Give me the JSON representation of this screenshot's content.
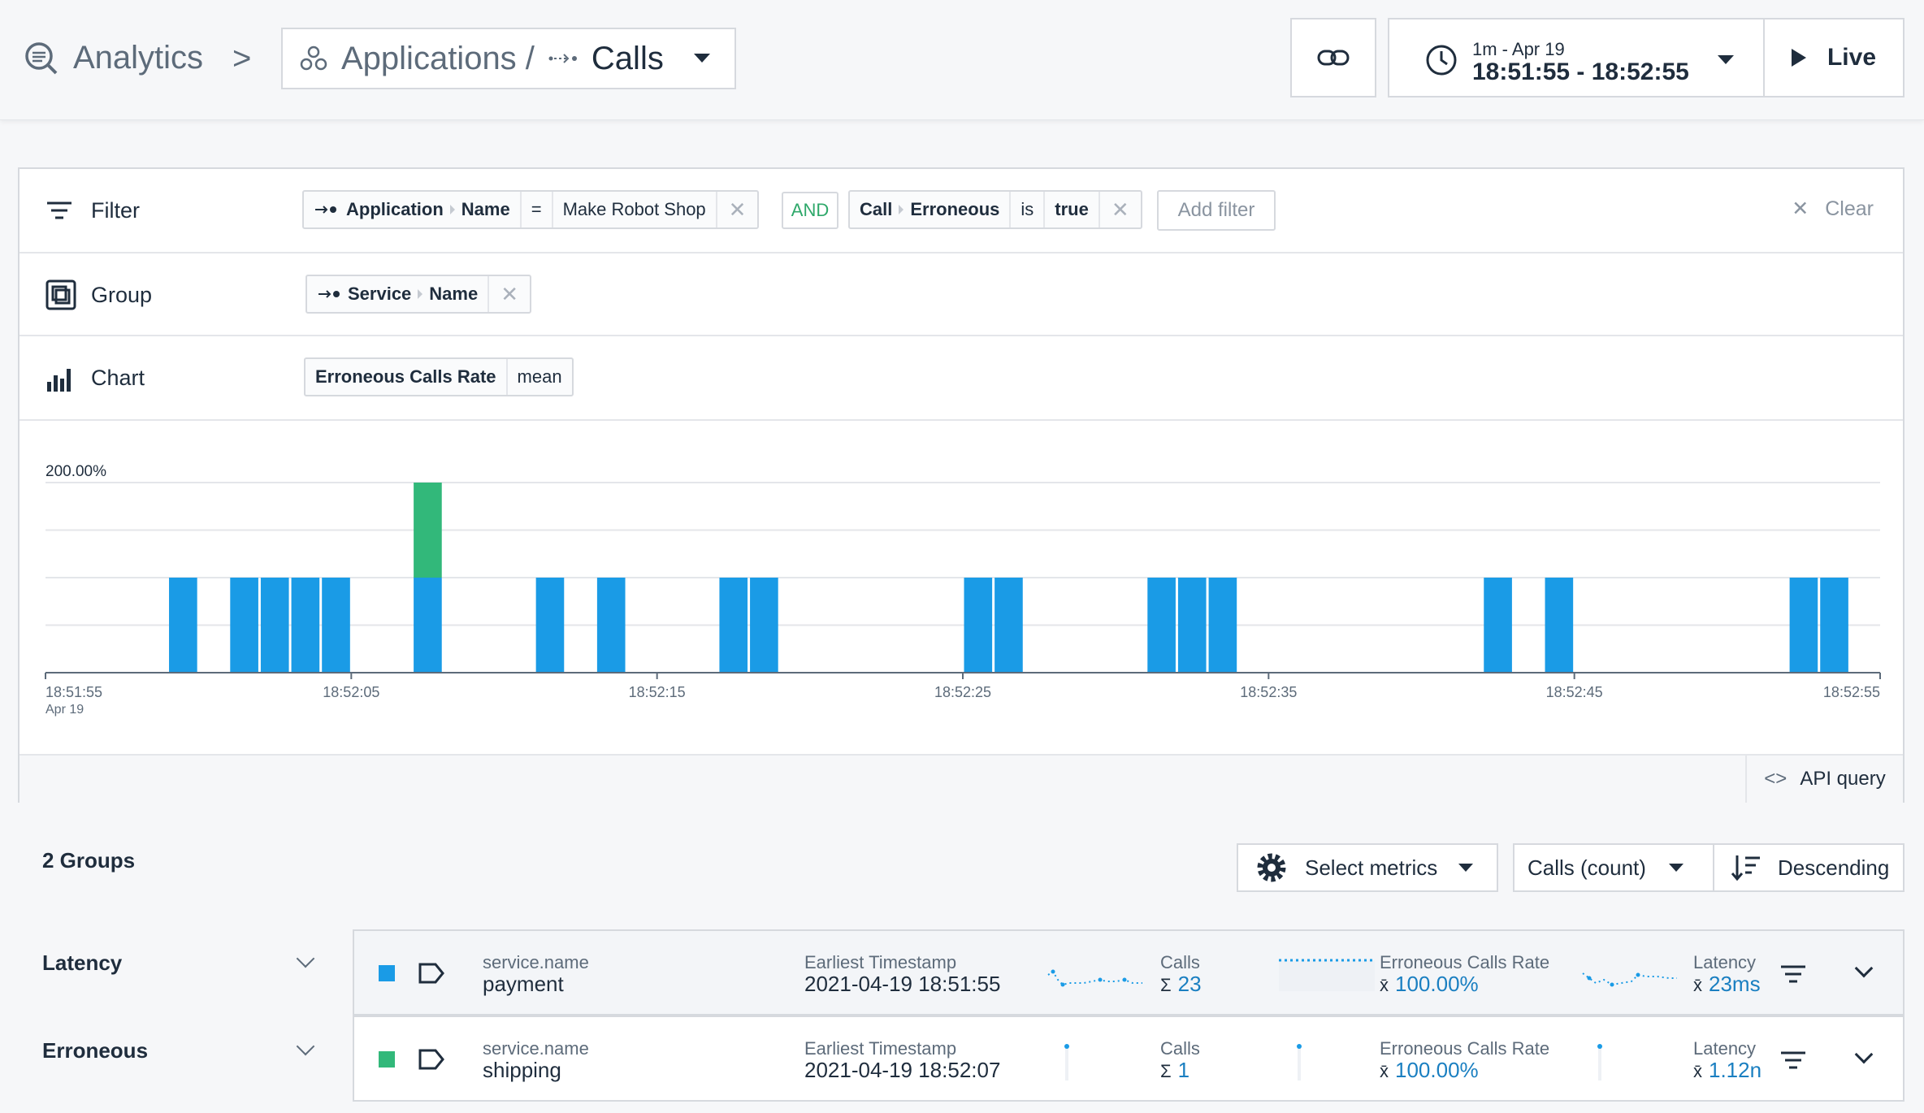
{
  "header": {
    "analytics_label": "Analytics",
    "breadcrumb_sep": ">",
    "applications_label": "Applications /",
    "calls_label": "Calls",
    "time_range_top": "1m - Apr 19",
    "time_range_main": "18:51:55 - 18:52:55",
    "live_label": "Live"
  },
  "filter": {
    "label": "Filter",
    "chip1": {
      "entity": "Application",
      "attr": "Name",
      "op": "=",
      "value": "Make Robot Shop"
    },
    "and_label": "AND",
    "chip2": {
      "entity": "Call",
      "attr": "Erroneous",
      "op": "is",
      "value": "true"
    },
    "add_filter": "Add filter",
    "clear": "Clear"
  },
  "group": {
    "label": "Group",
    "chip": {
      "entity": "Service",
      "attr": "Name"
    }
  },
  "chart_row": {
    "label": "Chart",
    "metric": "Erroneous Calls Rate",
    "aggregation": "mean"
  },
  "api_query": "API query",
  "chart_data": {
    "type": "bar",
    "stacked": true,
    "ylabel_top": "200.00%",
    "ylim": [
      0,
      200
    ],
    "grid": true,
    "x_ticks": [
      "18:51:55",
      "18:52:05",
      "18:52:15",
      "18:52:25",
      "18:52:35",
      "18:52:45",
      "18:52:55"
    ],
    "x_tick_sub": "Apr 19",
    "x_range_seconds": [
      0,
      60
    ],
    "series": [
      {
        "color": "#1a9be6",
        "x": [
          4,
          6,
          7,
          8,
          9,
          12,
          16,
          18,
          22,
          23,
          30,
          31,
          36,
          37,
          38,
          47,
          49,
          57,
          58
        ],
        "values": [
          100,
          100,
          100,
          100,
          100,
          100,
          100,
          100,
          100,
          100,
          100,
          100,
          100,
          100,
          100,
          100,
          100,
          100,
          100
        ]
      },
      {
        "color": "#32b87a",
        "x": [
          12
        ],
        "values": [
          100
        ]
      }
    ]
  },
  "groups": {
    "count_label": "2 Groups",
    "select_metrics": "Select metrics",
    "sort_by": "Calls (count)",
    "order": "Descending"
  },
  "sidebar": {
    "items": [
      {
        "label": "Latency"
      },
      {
        "label": "Erroneous"
      }
    ]
  },
  "rows": [
    {
      "color": "#1a9be6",
      "key_label": "service.name",
      "key_value": "payment",
      "ts_label": "Earliest Timestamp",
      "ts_value": "2021-04-19 18:51:55",
      "calls_label": "Calls",
      "calls_sym": "Σ",
      "calls_value": "23",
      "ecr_label": "Erroneous Calls Rate",
      "ecr_sym": "x̄",
      "ecr_value": "100.00%",
      "lat_label": "Latency",
      "lat_sym": "x̄",
      "lat_value": "23ms"
    },
    {
      "color": "#32b87a",
      "key_label": "service.name",
      "key_value": "shipping",
      "ts_label": "Earliest Timestamp",
      "ts_value": "2021-04-19 18:52:07",
      "calls_label": "Calls",
      "calls_sym": "Σ",
      "calls_value": "1",
      "ecr_label": "Erroneous Calls Rate",
      "ecr_sym": "x̄",
      "ecr_value": "100.00%",
      "lat_label": "Latency",
      "lat_sym": "x̄",
      "lat_value": "1.12n"
    }
  ]
}
